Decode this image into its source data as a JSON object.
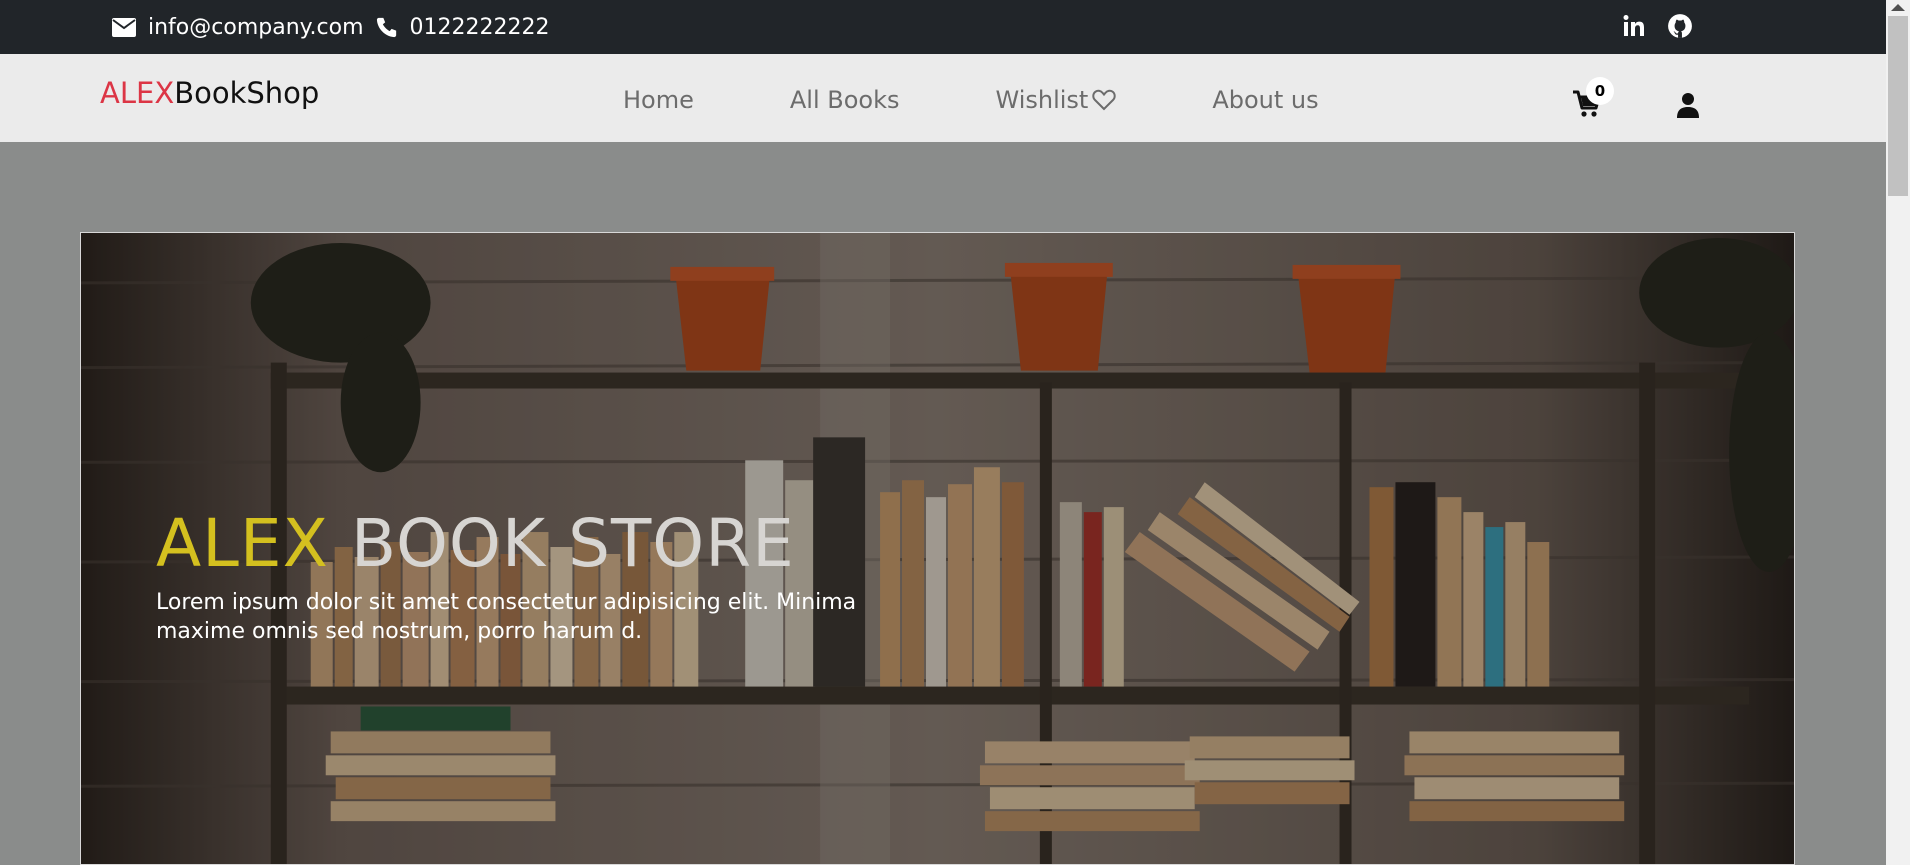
{
  "topbar": {
    "email": "info@company.com",
    "phone": "0122222222",
    "icons": {
      "email": "envelope-icon",
      "phone": "phone-icon",
      "linkedin": "linkedin-icon",
      "github": "github-icon"
    }
  },
  "navbar": {
    "brand_part1": "ALEX",
    "brand_part2": "BookShop",
    "links": [
      {
        "label": "Home"
      },
      {
        "label": "All Books"
      },
      {
        "label": "Wishlist"
      },
      {
        "label": "About us"
      }
    ],
    "cart_count": "0",
    "icons": {
      "wishlist": "heart-icon",
      "cart": "cart-icon",
      "user": "user-icon"
    }
  },
  "hero": {
    "title_part1": "ALEX",
    "title_part2": " BOOK STORE",
    "text": "Lorem ipsum dolor sit amet consectetur adipisicing elit. Minima maxime omnis sed nostrum, porro harum d."
  },
  "colors": {
    "topbar_bg": "#212529",
    "navbar_bg": "#ebebeb",
    "brand_red": "#dc3545",
    "title_yellow": "#d4c01f",
    "page_bg": "#8a8c8b"
  }
}
